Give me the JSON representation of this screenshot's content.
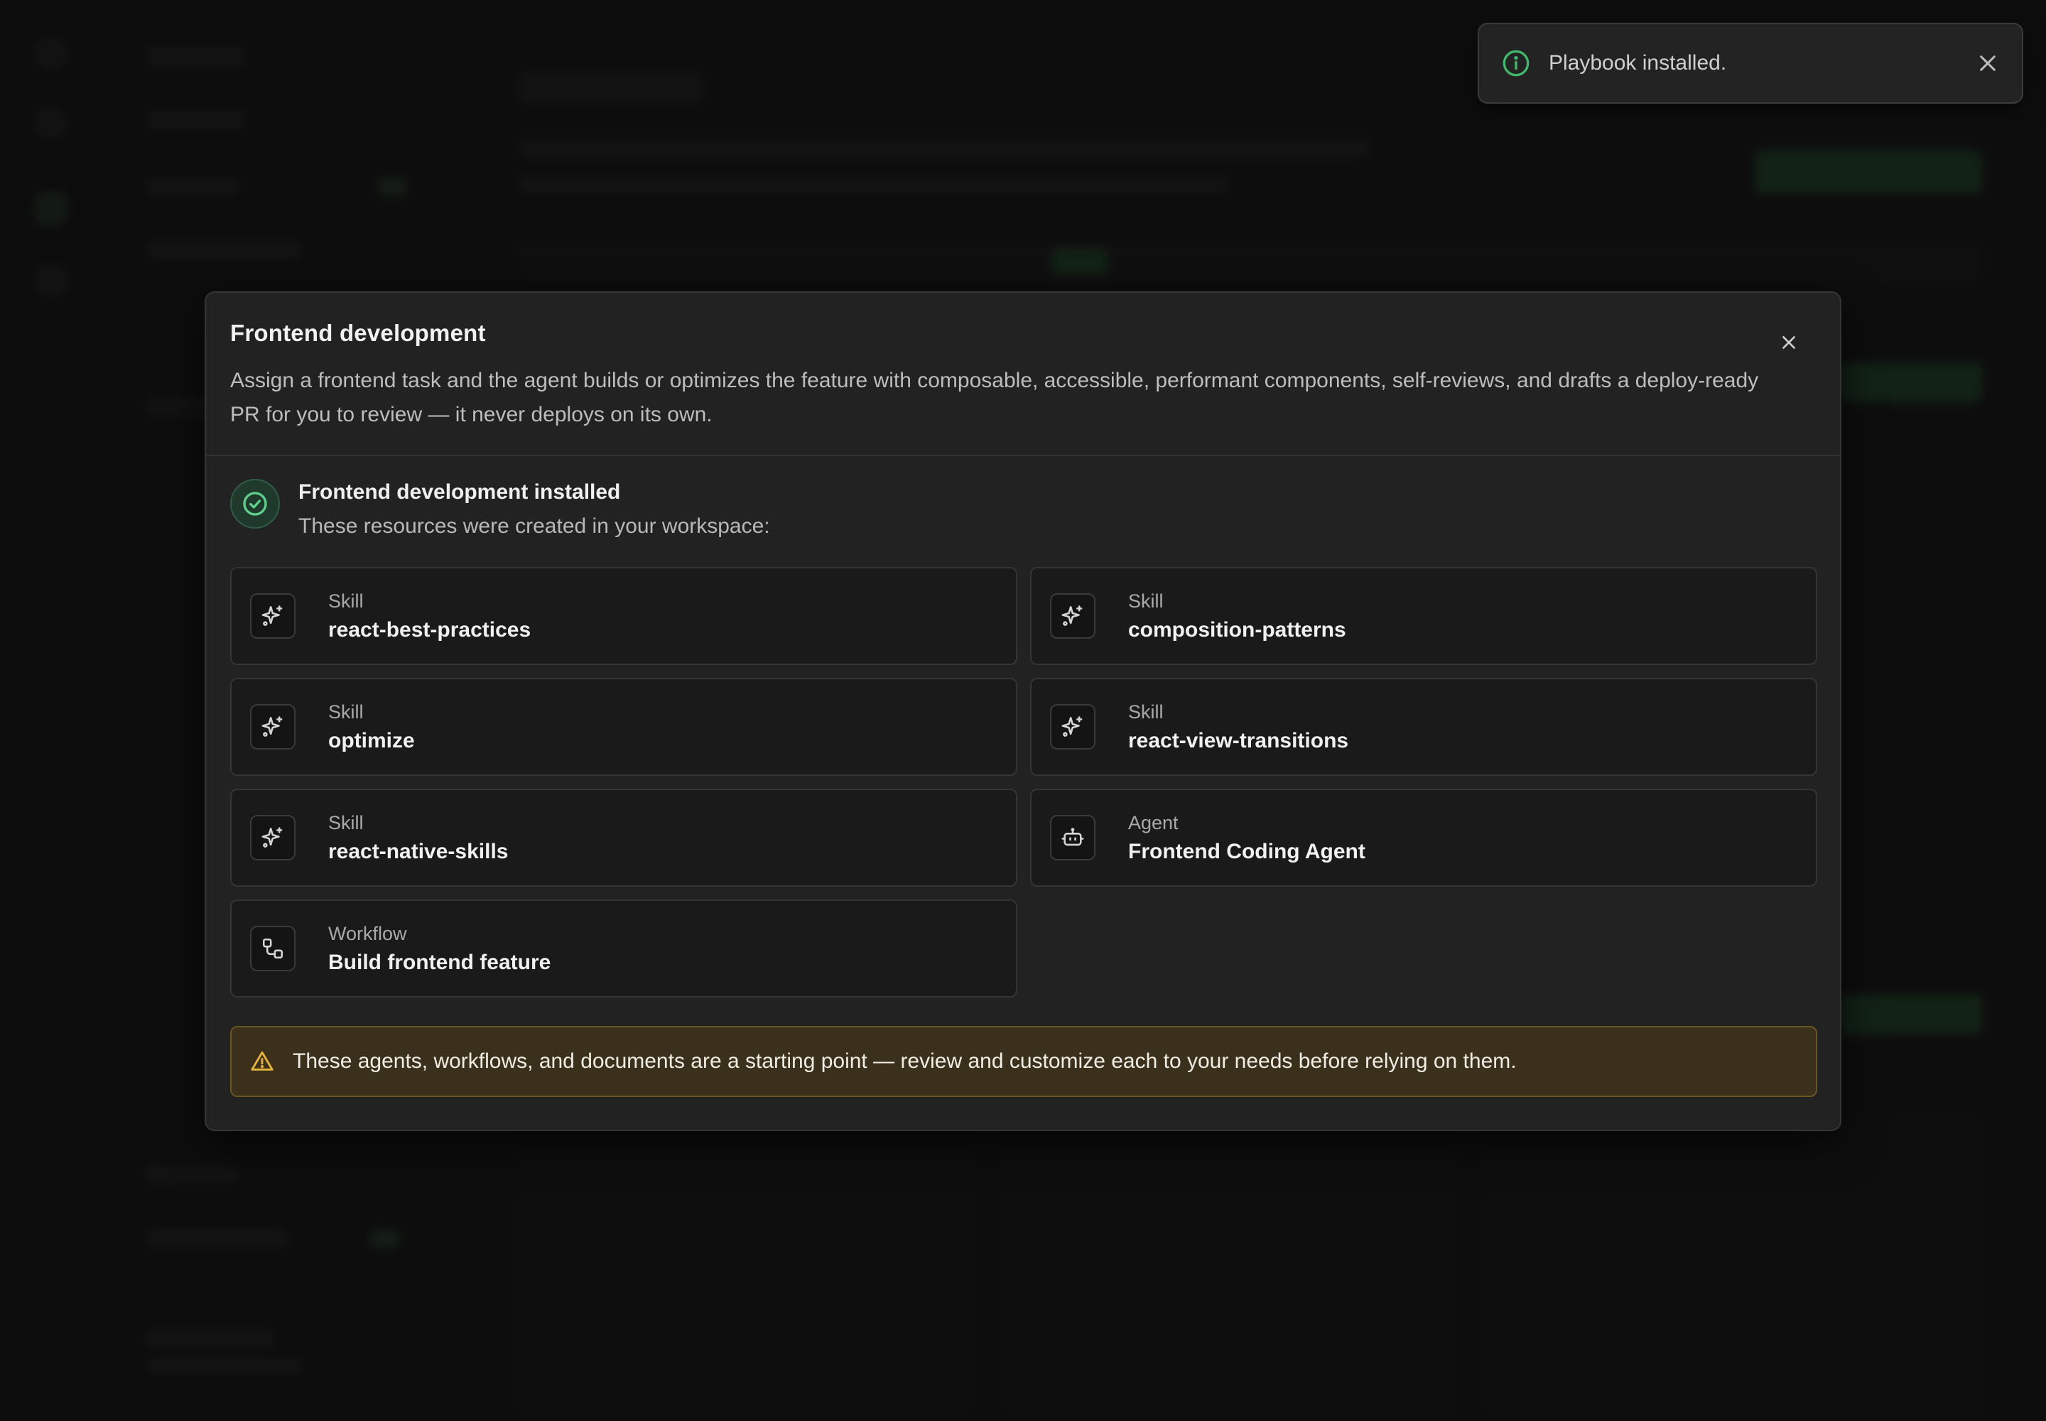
{
  "toast": {
    "message": "Playbook installed.",
    "icon": "info-circle-icon",
    "close_icon": "close-icon"
  },
  "modal": {
    "title": "Frontend development",
    "description": "Assign a frontend task and the agent builds or optimizes the feature with composable, accessible, performant components, self-reviews, and drafts a deploy-ready PR for you to review — it never deploys on its own.",
    "installed_title": "Frontend development installed",
    "installed_subtitle": "These resources were created in your workspace:",
    "resources": [
      {
        "type": "Skill",
        "name": "react-best-practices",
        "icon": "sparkle-icon"
      },
      {
        "type": "Skill",
        "name": "composition-patterns",
        "icon": "sparkle-icon"
      },
      {
        "type": "Skill",
        "name": "optimize",
        "icon": "sparkle-icon"
      },
      {
        "type": "Skill",
        "name": "react-view-transitions",
        "icon": "sparkle-icon"
      },
      {
        "type": "Skill",
        "name": "react-native-skills",
        "icon": "sparkle-icon"
      },
      {
        "type": "Agent",
        "name": "Frontend Coding Agent",
        "icon": "robot-icon"
      },
      {
        "type": "Workflow",
        "name": "Build frontend feature",
        "icon": "workflow-icon"
      }
    ],
    "warning": "These agents, workflows, and documents are a starting point — review and customize each to your needs before relying on them."
  },
  "colors": {
    "accent_green": "#3fb96a",
    "warning_amber": "#e8b43a",
    "modal_bg": "#222222"
  }
}
